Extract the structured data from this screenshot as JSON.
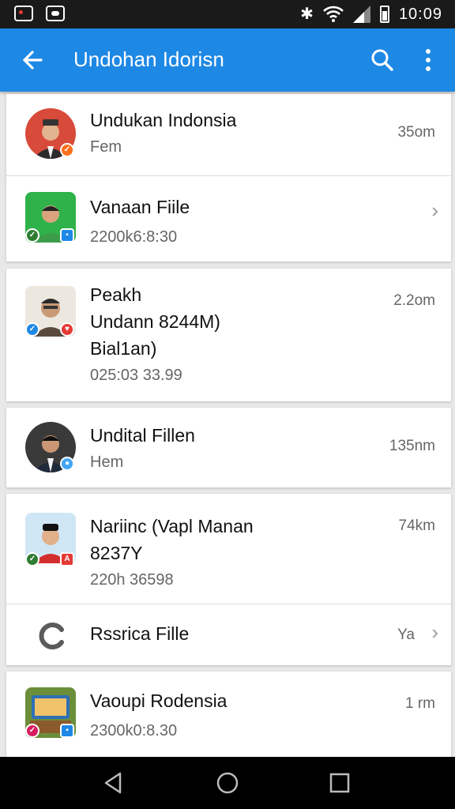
{
  "status_bar": {
    "time": "10:09"
  },
  "app_bar": {
    "title": "Undohan Idorisn"
  },
  "items": [
    {
      "name": "Undukan Indonsia",
      "sub": "Fem",
      "time": "35om"
    },
    {
      "name": "Vanaan Fiile",
      "sub": "2200k6:8:30"
    },
    {
      "name": "Peakh",
      "line2": "Undann 8244M)",
      "line3": "Bial1an)",
      "sub": "025:03 33.99",
      "time": "2.2om"
    },
    {
      "name": "Undital Fillen",
      "sub": "Hem",
      "time": "135nm"
    },
    {
      "name": "Nariinc",
      "name_extra": "(Vapl Manan",
      "line2": "8237Y",
      "sub": "220h 36598",
      "time": "74km"
    },
    {
      "name": "Rssrica Fille",
      "time": "Ya"
    },
    {
      "name": "Vaoupi Rodensia",
      "sub": "2300k0:8.30",
      "time": "1 rm"
    }
  ],
  "colors": {
    "app_bar": "#1e88e5",
    "status_bar": "#1a1a1a",
    "nav_bar": "#000000"
  }
}
